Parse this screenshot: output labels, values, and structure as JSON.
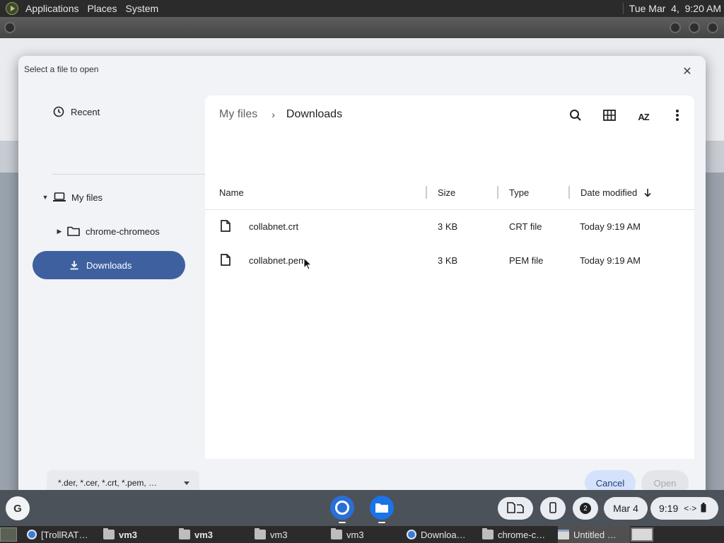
{
  "gnome_top": {
    "menus": [
      "Applications",
      "Places",
      "System"
    ],
    "clock": "Tue Mar  4,  9:20 AM"
  },
  "dialog": {
    "title": "Select a file to open",
    "close_icon": "close-icon",
    "sidebar": {
      "recent": "Recent",
      "my_files": "My files",
      "chrome_chromeos": "chrome-chromeos",
      "downloads": "Downloads"
    },
    "breadcrumb": {
      "root": "My files",
      "separator": "›",
      "current": "Downloads"
    },
    "toolbar": {
      "sort_label": "AZ"
    },
    "columns": {
      "name": "Name",
      "size": "Size",
      "type": "Type",
      "date": "Date modified"
    },
    "files": [
      {
        "name": "collabnet.crt",
        "size": "3 KB",
        "type": "CRT file",
        "date": "Today 9:19 AM"
      },
      {
        "name": "collabnet.pem",
        "size": "3 KB",
        "type": "PEM file",
        "date": "Today 9:19 AM"
      }
    ],
    "footer": {
      "filter": "*.der, *.cer, *.crt, *.pem, …",
      "cancel": "Cancel",
      "open": "Open"
    }
  },
  "shelf": {
    "launcher_label": "G",
    "notification_count": "2",
    "date": "Mar 4",
    "time": "9:19"
  },
  "taskbar": {
    "tasks": [
      "[TrollRAT…",
      "vm3",
      "vm3",
      "vm3",
      "vm3",
      "Downloa…",
      "chrome-c…",
      "Untitled …"
    ]
  },
  "colors": {
    "selected_nav": "#3e609f",
    "cancel_bg": "#d6e2fb",
    "shelf_bg": "#4c5259"
  }
}
